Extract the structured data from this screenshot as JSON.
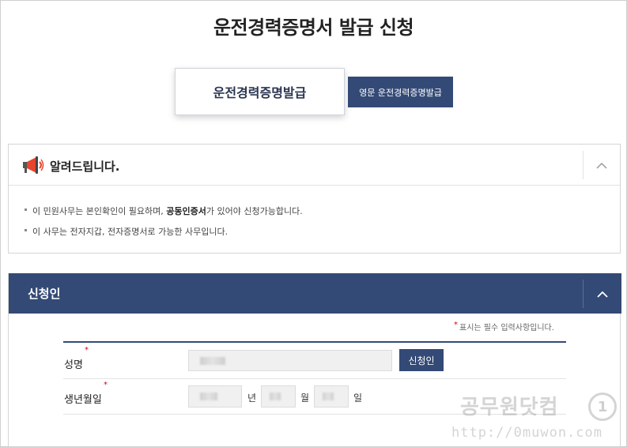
{
  "page_title": "운전경력증명서 발급 신청",
  "tabs": {
    "main": "운전경력증명발급",
    "english": "영문 운전경력증명발급"
  },
  "notice": {
    "title": "알려드립니다.",
    "item1_before": "이 민원사무는 본인확인이 필요하며, ",
    "item1_bold": "공동인증서",
    "item1_after": "가 있어야 신청가능합니다.",
    "item2": "이 사무는 전자지갑, 전자증명서로 가능한 사무입니다."
  },
  "applicant": {
    "title": "신청인",
    "required_note": "표시는 필수 입력사항입니다.",
    "required_mark": "*",
    "name_label": "성명",
    "apply_button": "신청인",
    "birth_label": "생년월일",
    "year_unit": "년",
    "month_unit": "월",
    "day_unit": "일"
  },
  "watermark": {
    "text": "공무원닷컴",
    "circle": "1",
    "url": "http://0muwon.com"
  },
  "colors": {
    "accent": "#344a76",
    "required": "#d0021b"
  }
}
